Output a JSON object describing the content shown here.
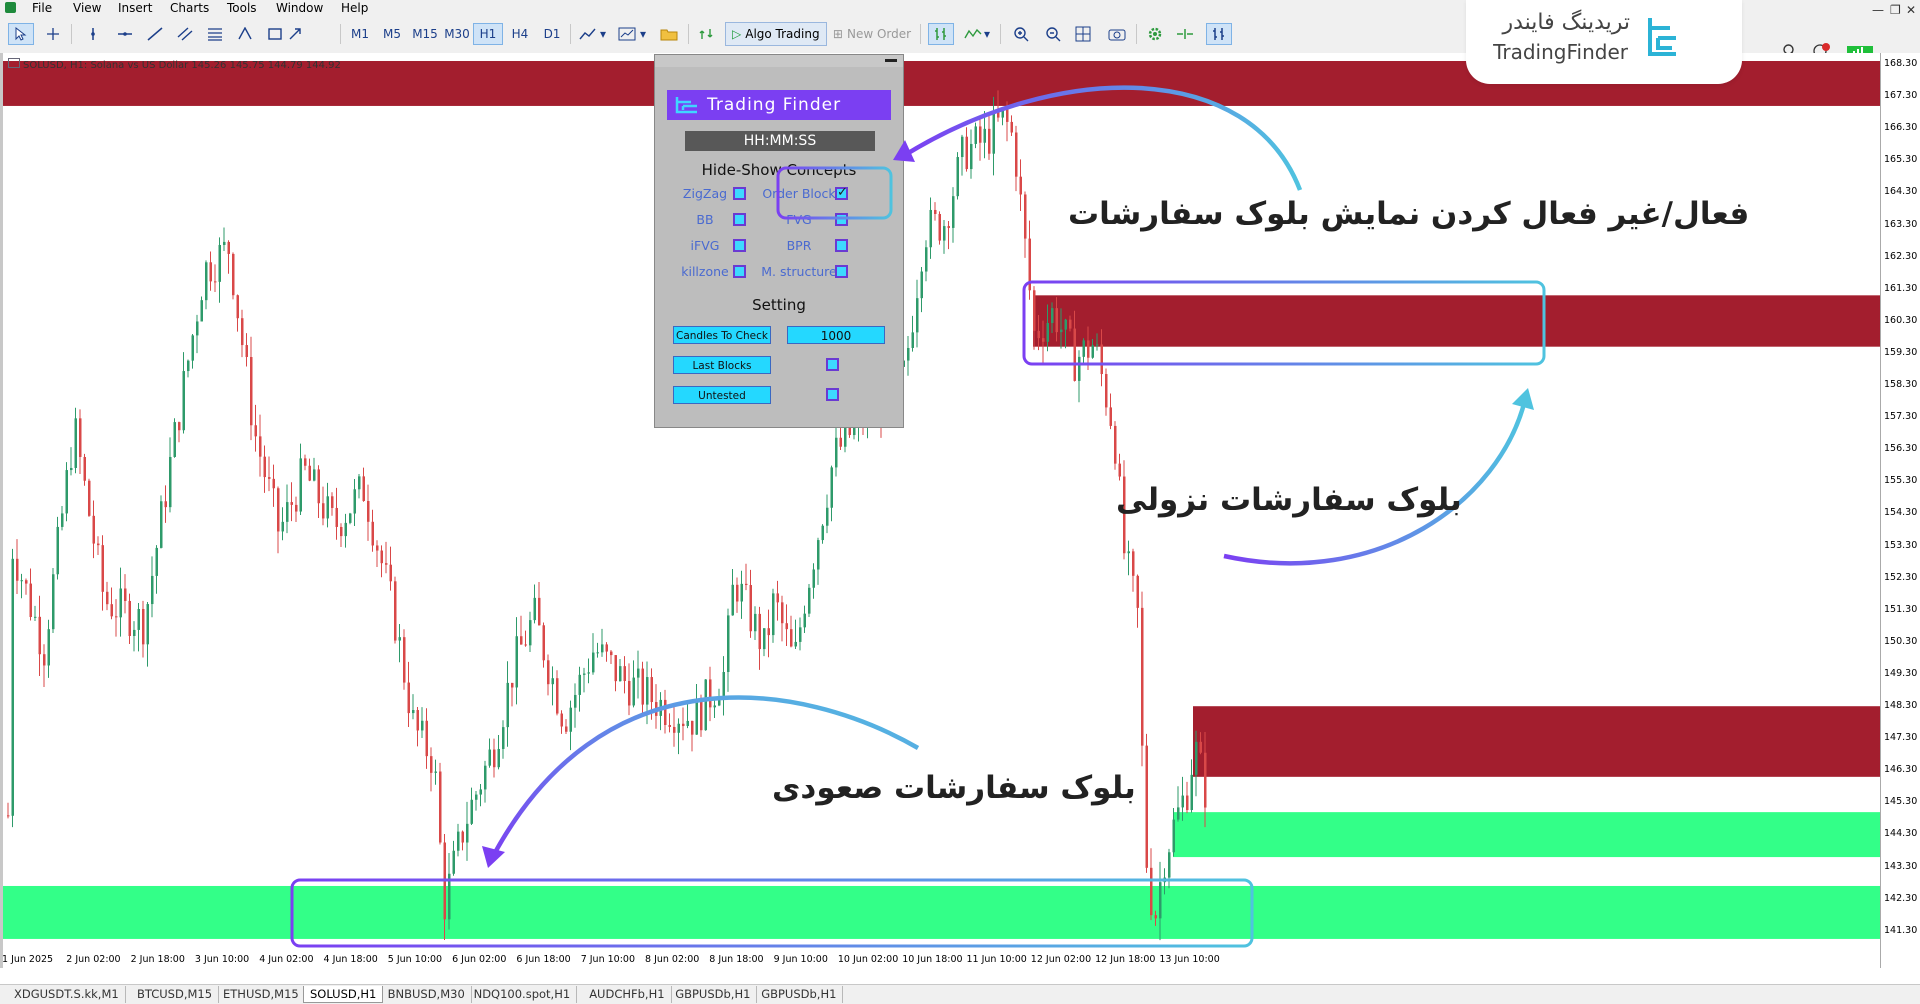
{
  "menu": {
    "items": [
      "File",
      "View",
      "Insert",
      "Charts",
      "Tools",
      "Window",
      "Help"
    ]
  },
  "toolbar": {
    "timeframes": [
      "M1",
      "M5",
      "M15",
      "M30",
      "H1",
      "H4",
      "D1"
    ],
    "active_timeframe": "H1",
    "algo_trading_label": "Algo Trading",
    "new_order_label": "New Order"
  },
  "chart": {
    "info": "SOLUSD, H1:  Solana vs US Dollar  145.26 145.75 144.79 144.92",
    "price_labels": [
      "168.30",
      "167.30",
      "166.30",
      "165.30",
      "164.30",
      "163.30",
      "162.30",
      "161.30",
      "160.30",
      "159.30",
      "158.30",
      "157.30",
      "156.30",
      "155.30",
      "154.30",
      "153.30",
      "152.30",
      "151.30",
      "150.30",
      "149.30",
      "148.30",
      "147.30",
      "146.30",
      "145.30",
      "144.30",
      "143.30",
      "142.30",
      "141.30"
    ],
    "time_labels": [
      "1 Jun 2025",
      "2 Jun 02:00",
      "2 Jun 18:00",
      "3 Jun 10:00",
      "4 Jun 02:00",
      "4 Jun 18:00",
      "5 Jun 10:00",
      "6 Jun 02:00",
      "6 Jun 18:00",
      "7 Jun 10:00",
      "8 Jun 02:00",
      "8 Jun 18:00",
      "9 Jun 10:00",
      "10 Jun 02:00",
      "10 Jun 18:00",
      "11 Jun 10:00",
      "12 Jun 02:00",
      "12 Jun 18:00",
      "13 Jun 10:00"
    ],
    "colors": {
      "bull": "#2e9a6a",
      "bear": "#d94848",
      "supply": "#a31e2e",
      "demand": "#33ff88",
      "highlight": "#53c1e0"
    }
  },
  "panel": {
    "brand": "Trading Finder",
    "clock": "HH:MM:SS",
    "concepts_title": "Hide-Show Concepts",
    "concepts": [
      {
        "label": "ZigZag",
        "checked": false
      },
      {
        "label": "Order Block",
        "checked": true
      },
      {
        "label": "BB",
        "checked": false
      },
      {
        "label": "FVG",
        "checked": false
      },
      {
        "label": "iFVG",
        "checked": false
      },
      {
        "label": "BPR",
        "checked": false
      },
      {
        "label": "killzone",
        "checked": false
      },
      {
        "label": "M. structure",
        "checked": false
      }
    ],
    "setting_title": "Setting",
    "candles_label": "Candles To Check",
    "candles_value": "1000",
    "last_blocks_label": "Last Blocks",
    "untested_label": "Untested"
  },
  "annotations": {
    "toggle": "فعال/غیر فعال کردن نمایش بلوک سفارشات",
    "bearish": "بلوک سفارشات نزولی",
    "bullish": "بلوک سفارشات صعودی"
  },
  "watermark": {
    "fa": "تریدینگ فایندر",
    "en": "TradingFinder"
  },
  "tabs": [
    "XDGUSDT.S.kk,M1",
    "BTCUSD,M15",
    "ETHUSD,M15",
    "SOLUSD,H1",
    "BNBUSD,M30",
    "NDQ100.spot,H1",
    "AUDCHFb,H1",
    "GBPUSDb,H1",
    "GBPUSDb,H1"
  ],
  "active_tab": "SOLUSD,H1"
}
